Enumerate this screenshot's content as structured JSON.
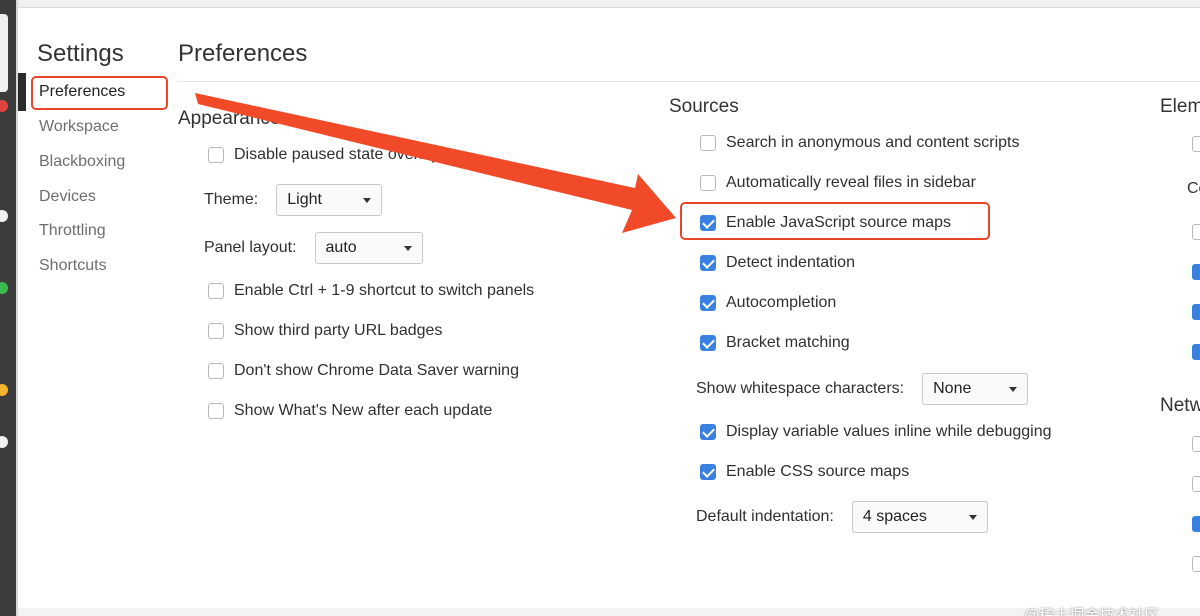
{
  "sidebar": {
    "title": "Settings",
    "items": [
      {
        "label": "Preferences",
        "active": true
      },
      {
        "label": "Workspace"
      },
      {
        "label": "Blackboxing"
      },
      {
        "label": "Devices"
      },
      {
        "label": "Throttling"
      },
      {
        "label": "Shortcuts"
      }
    ]
  },
  "page": {
    "title": "Preferences"
  },
  "appearance": {
    "title": "Appearance",
    "disable_paused_label": "Disable paused state overlay",
    "theme_label": "Theme:",
    "theme_value": "Light",
    "panel_layout_label": "Panel layout:",
    "panel_layout_value": "auto",
    "options": [
      {
        "label": "Enable Ctrl + 1-9 shortcut to switch panels",
        "checked": false
      },
      {
        "label": "Show third party URL badges",
        "checked": false
      },
      {
        "label": "Don't show Chrome Data Saver warning",
        "checked": false
      },
      {
        "label": "Show What's New after each update",
        "checked": false
      }
    ]
  },
  "sources": {
    "title": "Sources",
    "options": [
      {
        "label": "Search in anonymous and content scripts",
        "checked": false
      },
      {
        "label": "Automatically reveal files in sidebar",
        "checked": false
      },
      {
        "label": "Enable JavaScript source maps",
        "checked": true
      },
      {
        "label": "Detect indentation",
        "checked": true
      },
      {
        "label": "Autocompletion",
        "checked": true
      },
      {
        "label": "Bracket matching",
        "checked": true
      }
    ],
    "whitespace_label": "Show whitespace characters:",
    "whitespace_value": "None",
    "options2": [
      {
        "label": "Display variable values inline while debugging",
        "checked": true
      },
      {
        "label": "Enable CSS source maps",
        "checked": true
      }
    ],
    "indent_label": "Default indentation:",
    "indent_value": "4 spaces"
  },
  "elements": {
    "title": "Elem",
    "subtitle": "Co"
  },
  "network": {
    "title": "Netw"
  },
  "watermark": "@稀土掘金技术社区",
  "colors": {
    "accent": "#3a80e0",
    "annotation": "#e8462c"
  }
}
